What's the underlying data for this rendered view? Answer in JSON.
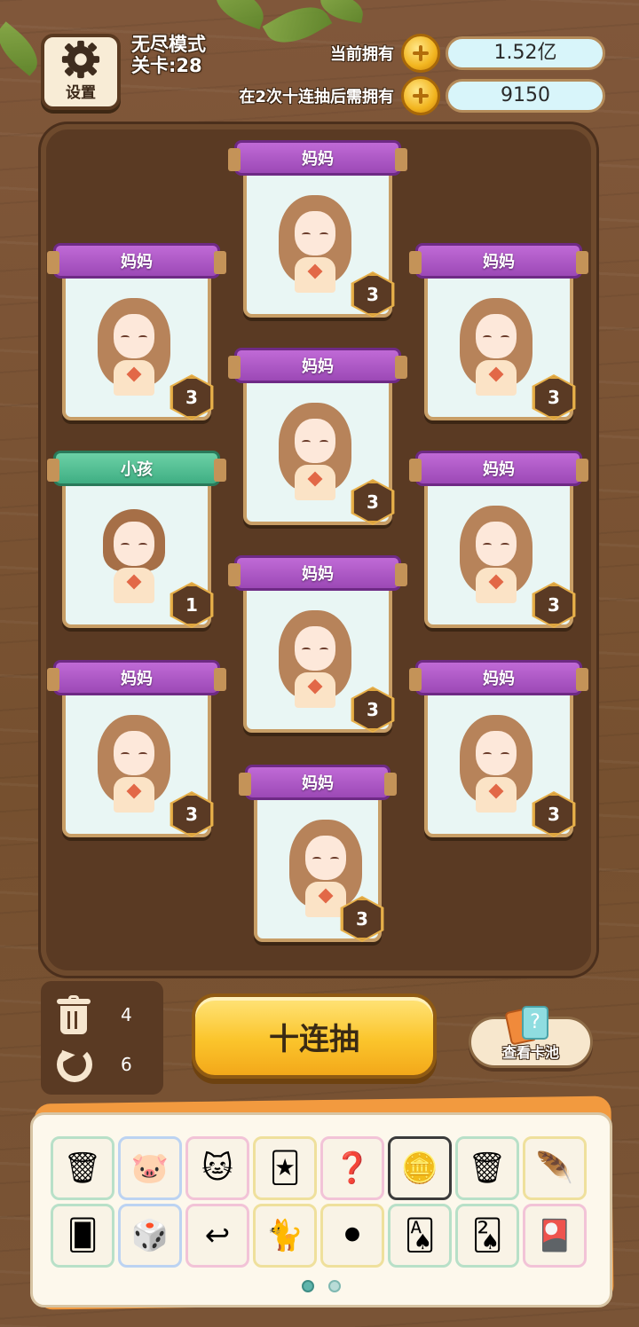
{
  "header": {
    "settings_label": "设置",
    "mode_label": "无尽模式",
    "level_label": "关卡:28",
    "owned_label": "当前拥有",
    "owned_value": "1.52亿",
    "required_label": "在2次十连抽后需拥有",
    "required_value": "9150"
  },
  "cards": [
    {
      "name": "妈妈",
      "level": "3",
      "type": "mom"
    },
    {
      "name": "妈妈",
      "level": "3",
      "type": "mom"
    },
    {
      "name": "妈妈",
      "level": "3",
      "type": "mom"
    },
    {
      "name": "妈妈",
      "level": "3",
      "type": "mom"
    },
    {
      "name": "小孩",
      "level": "1",
      "type": "kid"
    },
    {
      "name": "妈妈",
      "level": "3",
      "type": "mom"
    },
    {
      "name": "妈妈",
      "level": "3",
      "type": "mom"
    },
    {
      "name": "妈妈",
      "level": "3",
      "type": "mom"
    },
    {
      "name": "妈妈",
      "level": "3",
      "type": "mom"
    },
    {
      "name": "妈妈",
      "level": "3",
      "type": "mom"
    }
  ],
  "counters": {
    "trash_count": "4",
    "refresh_count": "6"
  },
  "actions": {
    "draw_ten_label": "十连抽",
    "view_pool_label": "查看卡池"
  },
  "items": [
    {
      "icon": "trash-coins-icon",
      "glyph": "🗑"
    },
    {
      "icon": "pink-blob-icon",
      "glyph": "🐷"
    },
    {
      "icon": "lucky-cat-icon",
      "glyph": "🐱"
    },
    {
      "icon": "purple-card-pack-icon",
      "glyph": "🃏"
    },
    {
      "icon": "question-multiply-icon",
      "glyph": "❓"
    },
    {
      "icon": "coin-plus-icon",
      "glyph": "🪙"
    },
    {
      "icon": "trash-coins-icon-2",
      "glyph": "🗑"
    },
    {
      "icon": "feather-charm-icon",
      "glyph": "🪶"
    },
    {
      "icon": "add-mystery-card-icon",
      "glyph": "🂠"
    },
    {
      "icon": "dice-icon",
      "glyph": "🎲"
    },
    {
      "icon": "undo-arrow-icon",
      "glyph": "↩"
    },
    {
      "icon": "lucky-cat-statue-icon",
      "glyph": "🐈"
    },
    {
      "icon": "black-hole-icon",
      "glyph": "⚫"
    },
    {
      "icon": "card-coins-icon",
      "glyph": "🂡"
    },
    {
      "icon": "card-double-icon",
      "glyph": "🂢"
    },
    {
      "icon": "mystery-card-pack-icon",
      "glyph": "🎴"
    }
  ],
  "pagination": {
    "pages": 2,
    "current": 1
  },
  "colors": {
    "mom_banner": "#9c49b6",
    "kid_banner": "#3fae83",
    "draw_button": "#fbc52c"
  }
}
